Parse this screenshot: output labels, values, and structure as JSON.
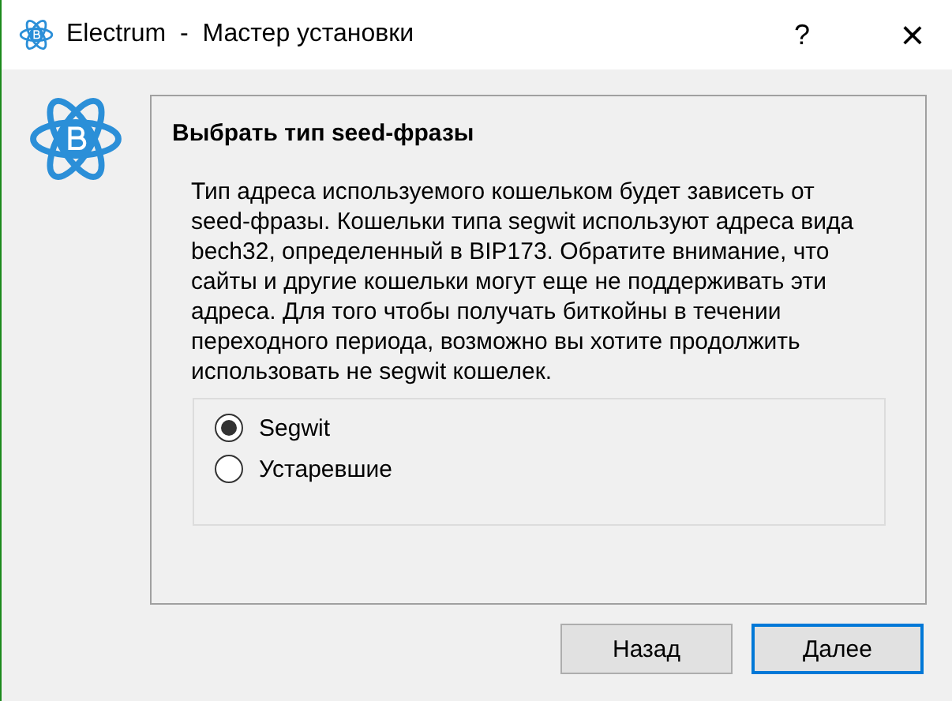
{
  "window": {
    "title": "Electrum  -  Мастер установки",
    "help": "?",
    "close": "×"
  },
  "page": {
    "heading": "Выбрать тип seed-фразы",
    "description": "Тип адреса используемого кошельком будет зависеть от seed-фразы. Кошельки типа segwit используют адреса вида bech32, определенный в BIP173. Обратите внимание, что сайты и другие кошельки могут еще не поддерживать эти адреса. Для того чтобы получать биткойны в течении переходного периода, возможно вы хотите продолжить использовать не segwit кошелек.",
    "options": [
      {
        "label": "Segwit",
        "selected": true
      },
      {
        "label": "Устаревшие",
        "selected": false
      }
    ]
  },
  "buttons": [
    {
      "label": "Назад",
      "default": false
    },
    {
      "label": "Далее",
      "default": true
    }
  ]
}
